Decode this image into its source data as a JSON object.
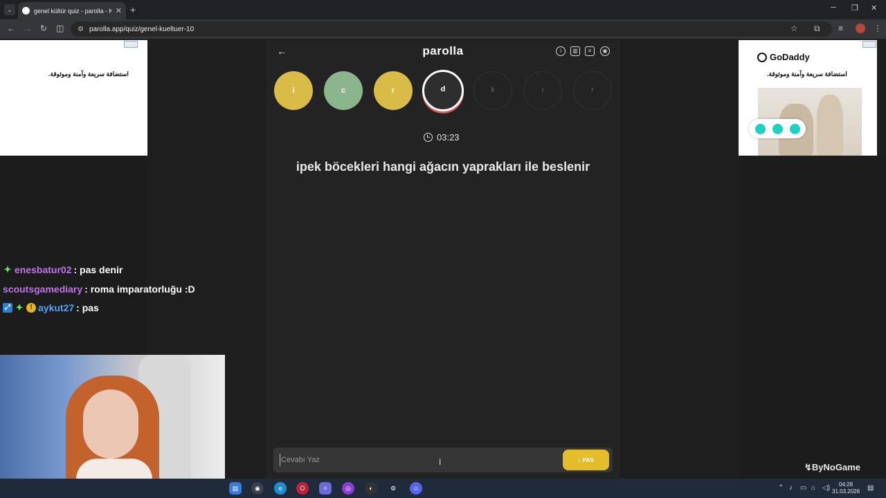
{
  "browser": {
    "tab_title": "genel kültür quiz - parolla - Kel",
    "tab_close": "✕",
    "new_tab": "+",
    "url": "parolla.app/quiz/genel-kueltuer-10"
  },
  "ads": {
    "left_text": "استضافة سريعة وآمنة وموثوقة.",
    "right_brand": "GoDaddy",
    "right_text": "استضافة سريعة وآمنة وموثوقة."
  },
  "quiz": {
    "brand": "parolla",
    "letters": [
      {
        "letter": "i",
        "state": "yellow"
      },
      {
        "letter": "c",
        "state": "green"
      },
      {
        "letter": "r",
        "state": "yellow"
      },
      {
        "letter": "d",
        "state": "active"
      },
      {
        "letter": "k",
        "state": "empty"
      },
      {
        "letter": "ı",
        "state": "empty"
      },
      {
        "letter": "r",
        "state": "empty"
      }
    ],
    "timer": "03:23",
    "question": "ipek böcekleri hangi ağacın yaprakları ile beslenir",
    "answer_placeholder": "Cevabı Yaz",
    "pass_label": "PAS"
  },
  "chat": [
    {
      "user": "enesbatur02",
      "message": " : pas denir"
    },
    {
      "user": "scoutsgamediary",
      "message": " : roma imparatorluğu :D"
    },
    {
      "user": "aykut27",
      "message": " : pas"
    }
  ],
  "overlay": {
    "sponsor": "ByNoGame"
  },
  "taskbar": {
    "time": "04:28",
    "date": "31.03.2026"
  },
  "colors": {
    "letter_yellow": "#d9bb47",
    "letter_green": "#8bb58c",
    "pass_button": "#e3bd2a",
    "chat_user_purple": "#c173e8",
    "chat_user_blue": "#4da6ff"
  }
}
